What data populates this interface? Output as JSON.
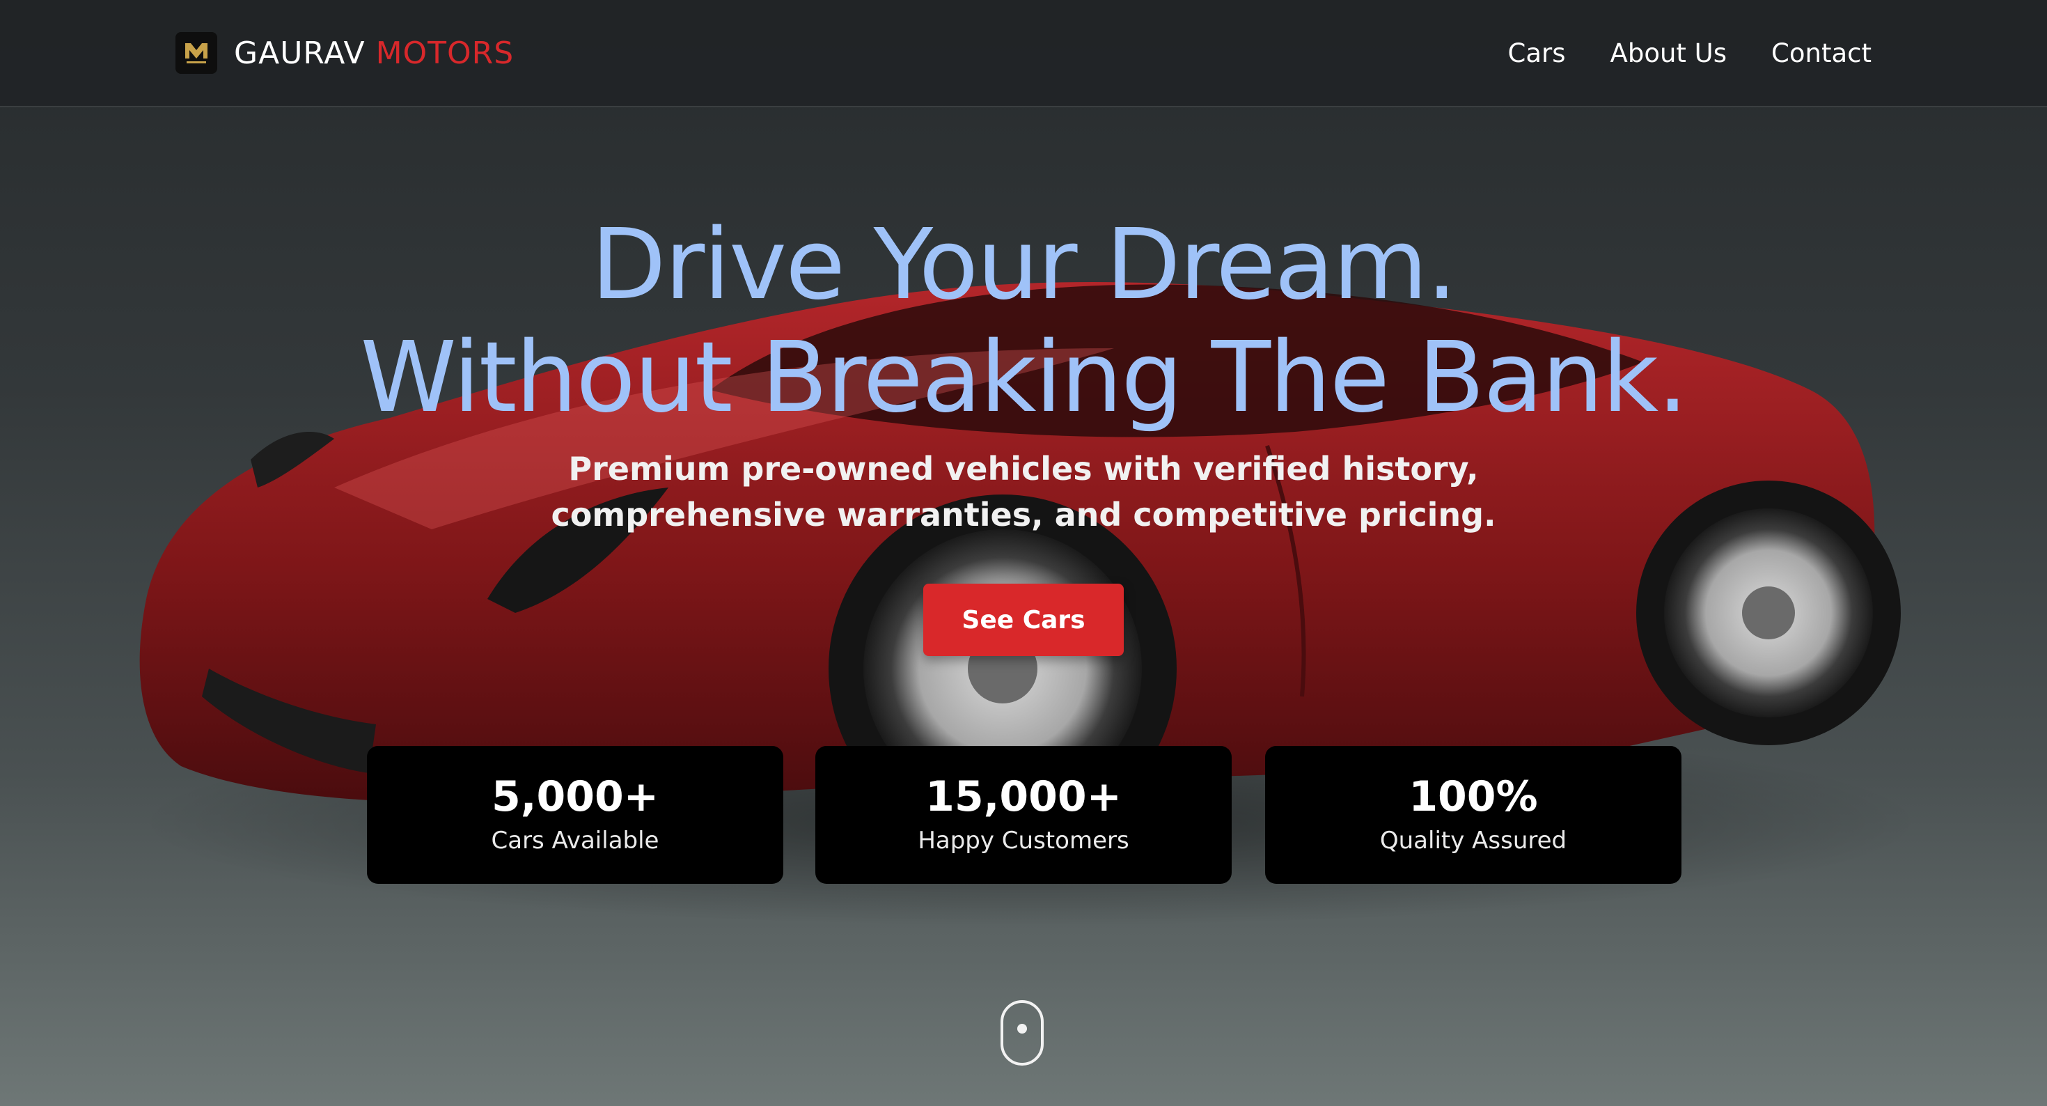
{
  "brand": {
    "name_primary": "GAURAV",
    "name_accent": "MOTORS",
    "logo_text": "GAURAV MOTORS",
    "accent_color": "#d8282b"
  },
  "nav": {
    "items": [
      {
        "label": "Cars"
      },
      {
        "label": "About Us"
      },
      {
        "label": "Contact"
      }
    ]
  },
  "hero": {
    "headline_line1": "Drive Your Dream.",
    "headline_line2": "Without Breaking The Bank.",
    "subtitle_line1": "Premium pre-owned vehicles with verified history,",
    "subtitle_line2": "comprehensive warranties, and competitive pricing.",
    "cta_label": "See Cars",
    "cta_color": "#d9282a",
    "headline_color": "#9fc2f8"
  },
  "stats": [
    {
      "value": "5,000+",
      "label": "Cars Available"
    },
    {
      "value": "15,000+",
      "label": "Happy Customers"
    },
    {
      "value": "100%",
      "label": "Quality Assured"
    }
  ],
  "icons": {
    "scroll": "mouse-scroll-icon",
    "logo": "brand-logo-icon"
  }
}
